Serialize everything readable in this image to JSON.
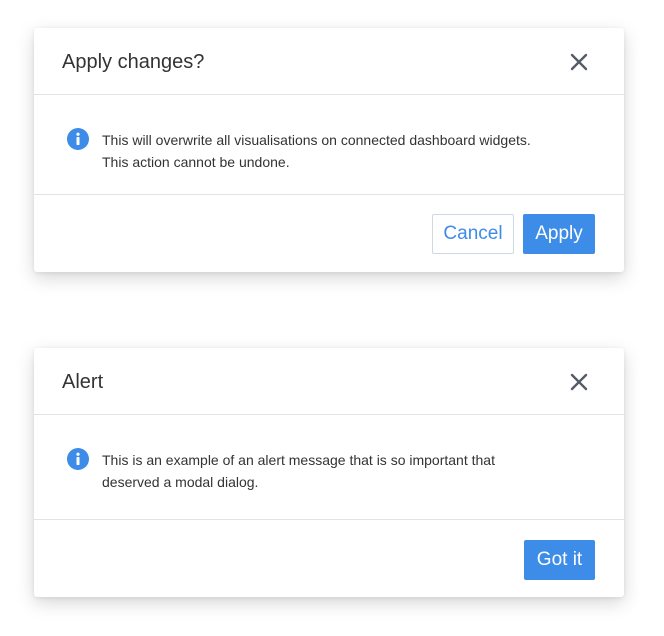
{
  "colors": {
    "accent": "#3d8ce8",
    "text": "#333333",
    "close_icon": "#555c66",
    "divider": "#e3e3e3"
  },
  "apply_dialog": {
    "title": "Apply changes?",
    "close_icon": "close-icon",
    "info_icon": "info-icon",
    "message_line1": "This will overwrite all visualisations on connected dashboard widgets.",
    "message_line2": "This action cannot be undone.",
    "cancel_label": "Cancel",
    "apply_label": "Apply"
  },
  "alert_dialog": {
    "title": "Alert",
    "close_icon": "close-icon",
    "info_icon": "info-icon",
    "message_line1": "This is an example of an alert message that is so important that",
    "message_line2": "deserved a modal dialog.",
    "confirm_label": "Got it"
  }
}
